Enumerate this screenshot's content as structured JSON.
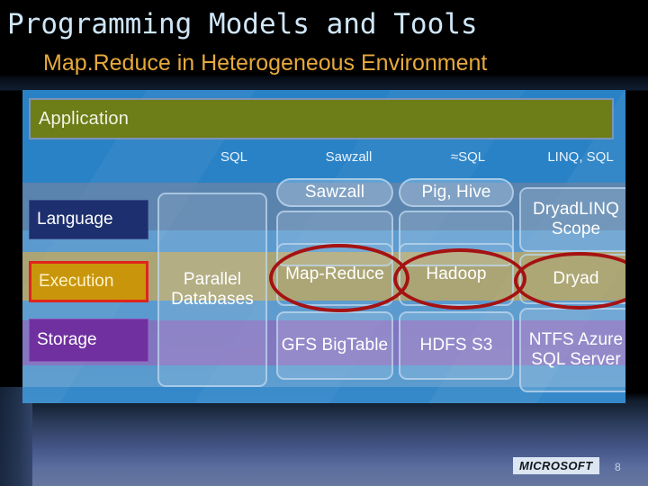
{
  "slide": {
    "title": "Programming Models and Tools",
    "subtitle": "Map.Reduce in Heterogeneous Environment",
    "title_color": "#cfe6f7",
    "subtitle_color": "#e7a93c",
    "background_color": "#000000"
  },
  "panel": {
    "background_color": "#2a82c6",
    "application_bar": {
      "label": "Application",
      "color": "#6d7d17"
    },
    "column_headers": [
      {
        "label": "SQL"
      },
      {
        "label": "Sawzall"
      },
      {
        "label": "≈SQL"
      },
      {
        "label": "LINQ, SQL"
      }
    ],
    "row_labels": [
      {
        "label": "Language",
        "color": "#1d2f6e"
      },
      {
        "label": "Execution",
        "color": "#c9960b",
        "highlight_border": "#e0241b"
      },
      {
        "label": "Storage",
        "color": "#7030a0"
      }
    ],
    "cells": {
      "language_pills": [
        {
          "label": "Sawzall"
        },
        {
          "label": "Pig, Hive"
        }
      ],
      "column_1": {
        "label": "Parallel Databases"
      },
      "language_row": [
        {
          "label": ""
        },
        {
          "label": ""
        },
        {
          "label": "DryadLINQ Scope"
        }
      ],
      "execution_row": [
        {
          "label": "Map-Reduce",
          "circled": true
        },
        {
          "label": "Hadoop",
          "circled": true
        },
        {
          "label": "Dryad",
          "circled": true
        }
      ],
      "storage_row": [
        {
          "label": "GFS BigTable"
        },
        {
          "label": "HDFS S3"
        },
        {
          "label": "NTFS Azure SQL Server"
        }
      ]
    },
    "annotation_color": "#a51212"
  },
  "footer": {
    "logo": "MICROSOFT",
    "page_number": "8"
  }
}
